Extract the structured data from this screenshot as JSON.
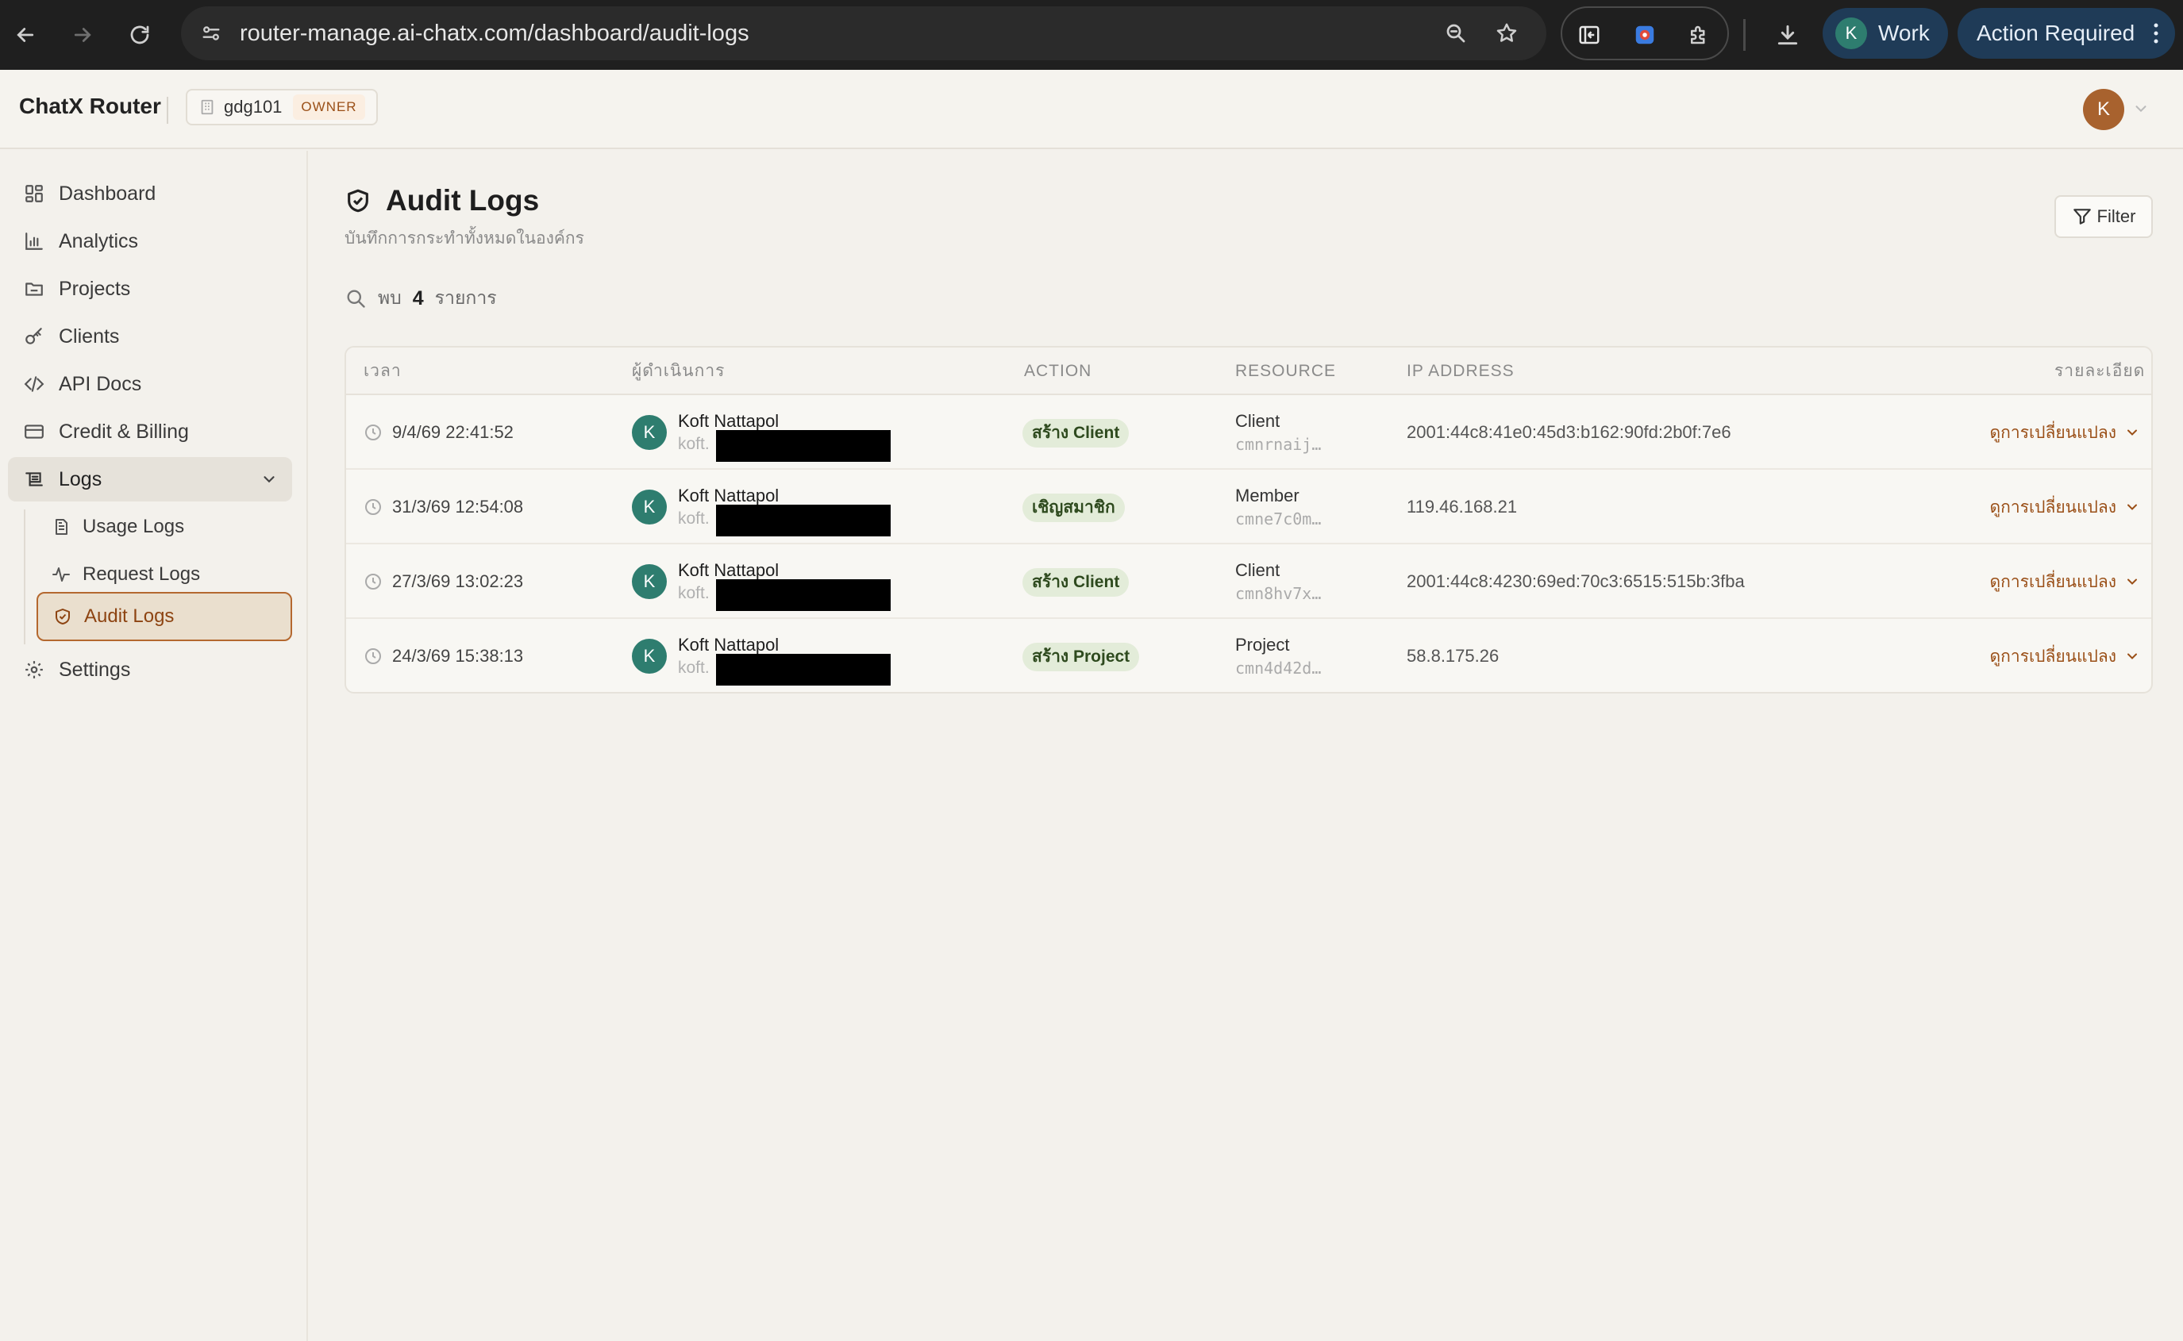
{
  "browser": {
    "url": "router-manage.ai-chatx.com/dashboard/audit-logs",
    "profile_initial": "K",
    "profile_label": "Work",
    "action_label": "Action Required"
  },
  "header": {
    "brand": "ChatX Router",
    "org_name": "gdg101",
    "org_role": "OWNER",
    "user_initial": "K"
  },
  "sidebar": {
    "items": [
      {
        "label": "Dashboard",
        "icon": "grid-icon"
      },
      {
        "label": "Analytics",
        "icon": "bar-chart-icon"
      },
      {
        "label": "Projects",
        "icon": "folder-icon"
      },
      {
        "label": "Clients",
        "icon": "key-icon"
      },
      {
        "label": "API Docs",
        "icon": "code-icon"
      },
      {
        "label": "Credit & Billing",
        "icon": "credit-card-icon"
      },
      {
        "label": "Logs",
        "icon": "logs-icon"
      }
    ],
    "logs_children": [
      {
        "label": "Usage Logs",
        "icon": "file-text-icon"
      },
      {
        "label": "Request Logs",
        "icon": "activity-icon"
      },
      {
        "label": "Audit Logs",
        "icon": "shield-check-icon"
      }
    ],
    "settings_label": "Settings"
  },
  "main": {
    "title": "Audit Logs",
    "subtitle": "บันทึกการกระทำทั้งหมดในองค์กร",
    "filter_label": "Filter",
    "count_prefix": "พบ",
    "count": "4",
    "count_suffix": "รายการ",
    "columns": [
      "เวลา",
      "ผู้ดำเนินการ",
      "ACTION",
      "RESOURCE",
      "IP ADDRESS",
      "รายละเอียด"
    ],
    "rows": [
      {
        "time": "9/4/69 22:41:52",
        "actor_initial": "K",
        "actor_name": "Koft Nattapol",
        "actor_email": "koft.",
        "action": "สร้าง Client",
        "resource_type": "Client",
        "resource_id": "cmnrnaij…",
        "ip": "2001:44c8:41e0:45d3:b162:90fd:2b0f:7e6",
        "detail": "ดูการเปลี่ยนแปลง"
      },
      {
        "time": "31/3/69 12:54:08",
        "actor_initial": "K",
        "actor_name": "Koft Nattapol",
        "actor_email": "koft.",
        "action": "เชิญสมาชิก",
        "resource_type": "Member",
        "resource_id": "cmne7c0m…",
        "ip": "119.46.168.21",
        "detail": "ดูการเปลี่ยนแปลง"
      },
      {
        "time": "27/3/69 13:02:23",
        "actor_initial": "K",
        "actor_name": "Koft Nattapol",
        "actor_email": "koft.",
        "action": "สร้าง Client",
        "resource_type": "Client",
        "resource_id": "cmn8hv7x…",
        "ip": "2001:44c8:4230:69ed:70c3:6515:515b:3fba",
        "detail": "ดูการเปลี่ยนแปลง"
      },
      {
        "time": "24/3/69 15:38:13",
        "actor_initial": "K",
        "actor_name": "Koft Nattapol",
        "actor_email": "koft.",
        "action": "สร้าง Project",
        "resource_type": "Project",
        "resource_id": "cmn4d42d…",
        "ip": "58.8.175.26",
        "detail": "ดูการเปลี่ยนแปลง"
      }
    ]
  },
  "colors": {
    "accent": "#b4682f",
    "avatar_green": "#2e7d6f",
    "badge_green_bg": "#e3ecd9"
  }
}
